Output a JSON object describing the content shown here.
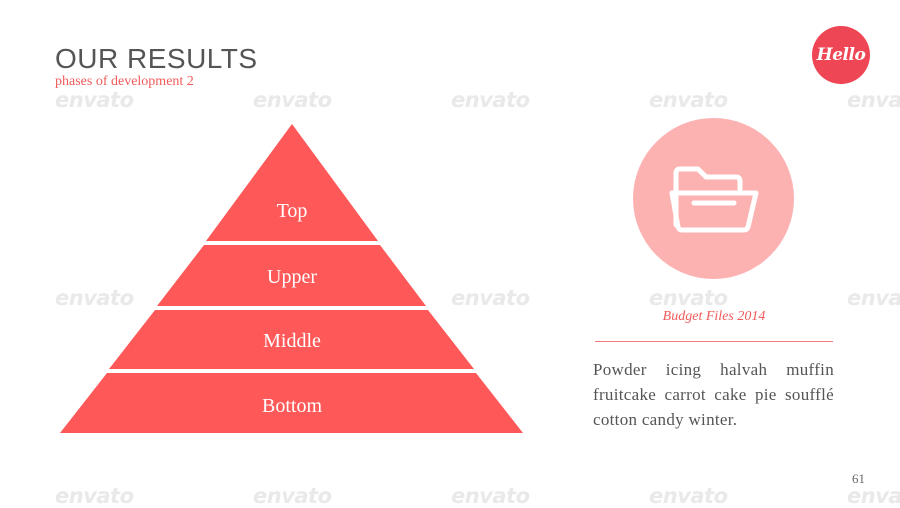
{
  "header": {
    "title": "OUR RESULTS",
    "subtitle": "phases of development 2"
  },
  "badge": {
    "text": "Hello",
    "color": "#ef4656"
  },
  "pyramid": {
    "tiers": [
      {
        "label": "Top"
      },
      {
        "label": "Upper"
      },
      {
        "label": "Middle"
      },
      {
        "label": "Bottom"
      }
    ],
    "color": "#fe5858"
  },
  "feature": {
    "icon": "folder-icon",
    "circle_color": "#fdb2b2",
    "caption": "Budget Files 2014",
    "body": "Powder icing halvah muffin fruitcake carrot cake pie soufflé cotton candy winter."
  },
  "page_number": "61",
  "watermark_text": "envato"
}
